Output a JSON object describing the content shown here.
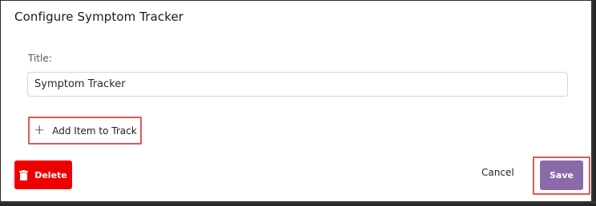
{
  "dialog": {
    "title": "Configure Symptom Tracker"
  },
  "title_field": {
    "label": "Title:",
    "value": "Symptom Tracker"
  },
  "add_item": {
    "icon": "plus-icon",
    "label": "Add Item to Track"
  },
  "actions": {
    "delete_label": "Delete",
    "delete_icon": "trash-icon",
    "cancel_label": "Cancel",
    "save_label": "Save"
  },
  "colors": {
    "delete_bg": "#ee0000",
    "save_bg": "#8a6aa8",
    "highlight": "#e05858"
  }
}
